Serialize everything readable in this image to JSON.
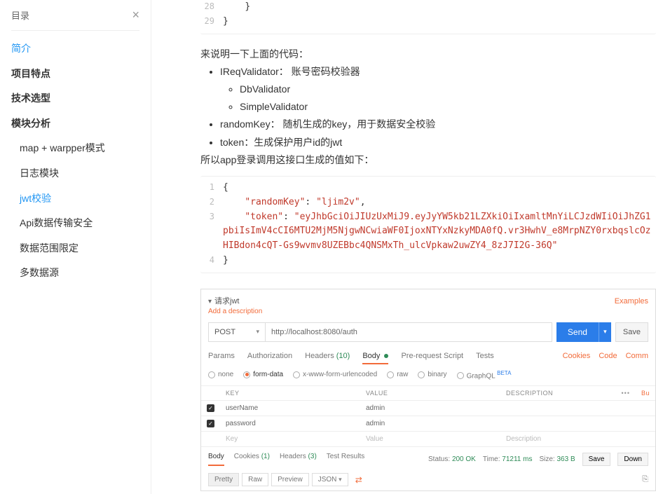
{
  "sidebar": {
    "title": "目录",
    "items": [
      {
        "label": "简介",
        "link": true,
        "bold": false
      },
      {
        "label": "项目特点",
        "link": false,
        "bold": true
      },
      {
        "label": "技术选型",
        "link": false,
        "bold": true
      },
      {
        "label": "模块分析",
        "link": false,
        "bold": true
      }
    ],
    "sub": [
      "map + warpper模式",
      "日志模块",
      "jwt校验",
      "Api数据传输安全",
      "数据范围限定",
      "多数据源"
    ],
    "active_sub": "jwt校验"
  },
  "code_top": {
    "lines": [
      {
        "n": "28",
        "t": "    }"
      },
      {
        "n": "29",
        "t": "}"
      }
    ]
  },
  "explain": {
    "intro": "来说明一下上面的代码：",
    "li1": "IReqValidator：  账号密码校验器",
    "li1a": "DbValidator",
    "li1b": "SimpleValidator",
    "li2": "randomKey：  随机生成的key，用于数据安全校验",
    "li3": "token：生成保护用户id的jwt",
    "outro": "所以app登录调用这接口生成的值如下："
  },
  "code_json": {
    "lines": [
      {
        "n": "1",
        "segments": [
          {
            "t": "{",
            "c": "plain"
          }
        ]
      },
      {
        "n": "2",
        "segments": [
          {
            "t": "    ",
            "c": "plain"
          },
          {
            "t": "\"randomKey\"",
            "c": "key"
          },
          {
            "t": ": ",
            "c": "plain"
          },
          {
            "t": "\"ljim2v\"",
            "c": "str"
          },
          {
            "t": ",",
            "c": "plain"
          }
        ]
      },
      {
        "n": "3",
        "segments": [
          {
            "t": "    ",
            "c": "plain"
          },
          {
            "t": "\"token\"",
            "c": "key"
          },
          {
            "t": ": ",
            "c": "plain"
          },
          {
            "t": "\"eyJhbGciOiJIUzUxMiJ9.eyJyYW5kb21LZXkiOiIxamltMnYiLCJzdWIiOiJhZG1pbiIsImV4cCI6MTU2MjM5NjgwNCwiaWF0IjoxNTYxNzkyMDA0fQ.vr3HwhV_e8MrpNZY0rxbqslcOzHIBdon4cQT-Gs9wvmv8UZEBbc4QNSMxTh_ulcVpkaw2uwZY4_8zJ7I2G-36Q\"",
            "c": "str"
          }
        ]
      },
      {
        "n": "4",
        "segments": [
          {
            "t": "}",
            "c": "plain"
          }
        ]
      }
    ]
  },
  "postman": {
    "title": "请求jwt",
    "examples": "Examples",
    "add_desc": "Add a description",
    "method": "POST",
    "url": "http://localhost:8080/auth",
    "send": "Send",
    "save": "Save",
    "tabs": {
      "params": "Params",
      "auth": "Authorization",
      "headers": "Headers",
      "headers_count": "(10)",
      "body": "Body",
      "pre": "Pre-request Script",
      "tests": "Tests",
      "cookies": "Cookies",
      "code": "Code",
      "comments": "Comm"
    },
    "body_opts": {
      "none": "none",
      "form": "form-data",
      "url": "x-www-form-urlencoded",
      "raw": "raw",
      "binary": "binary",
      "graphql": "GraphQL",
      "beta": "BETA"
    },
    "table": {
      "h_key": "KEY",
      "h_val": "VALUE",
      "h_desc": "DESCRIPTION",
      "bulk": "Bu",
      "rows": [
        {
          "key": "userName",
          "value": "admin"
        },
        {
          "key": "password",
          "value": "admin"
        }
      ],
      "ph_key": "Key",
      "ph_val": "Value",
      "ph_desc": "Description"
    },
    "resp": {
      "body": "Body",
      "cookies": "Cookies",
      "cookies_count": "(1)",
      "headers": "Headers",
      "headers_count": "(3)",
      "test": "Test Results",
      "status_lbl": "Status:",
      "status": "200 OK",
      "time_lbl": "Time:",
      "time": "71211 ms",
      "size_lbl": "Size:",
      "size": "363 B",
      "save": "Save",
      "download": "Down"
    },
    "view": {
      "pretty": "Pretty",
      "raw": "Raw",
      "preview": "Preview",
      "fmt": "JSON"
    }
  }
}
